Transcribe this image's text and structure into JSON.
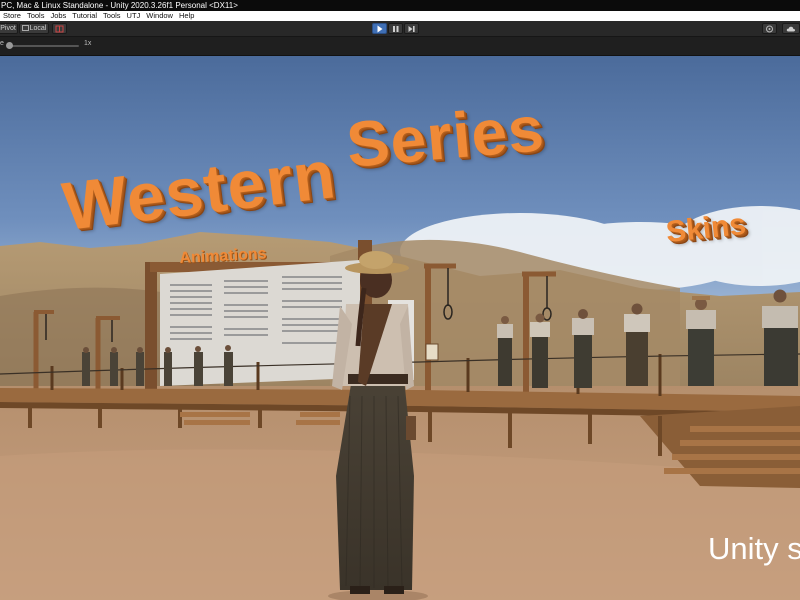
{
  "window": {
    "title": "PC, Mac & Linux Standalone - Unity 2020.3.26f1 Personal <DX11>"
  },
  "menu": {
    "items": [
      "Store",
      "Tools",
      "Jobs",
      "Tutorial",
      "Tools",
      "UTJ",
      "Window",
      "Help"
    ]
  },
  "toolbar": {
    "pivot_label": "Pivot",
    "local_label": "Local",
    "play_icon": "play-icon",
    "pause_icon": "pause-icon",
    "step_icon": "step-icon",
    "play_active_color": "#3f6fb5"
  },
  "game_view": {
    "scale_label": "e",
    "scale_value": "1x",
    "scale_level": 1.0
  },
  "scene": {
    "title_word1": "Western",
    "title_word2": "Series",
    "skins_label": "Skins",
    "animations_label": "Animations",
    "watermark": "Unity s",
    "title_color": "#f08a37"
  }
}
